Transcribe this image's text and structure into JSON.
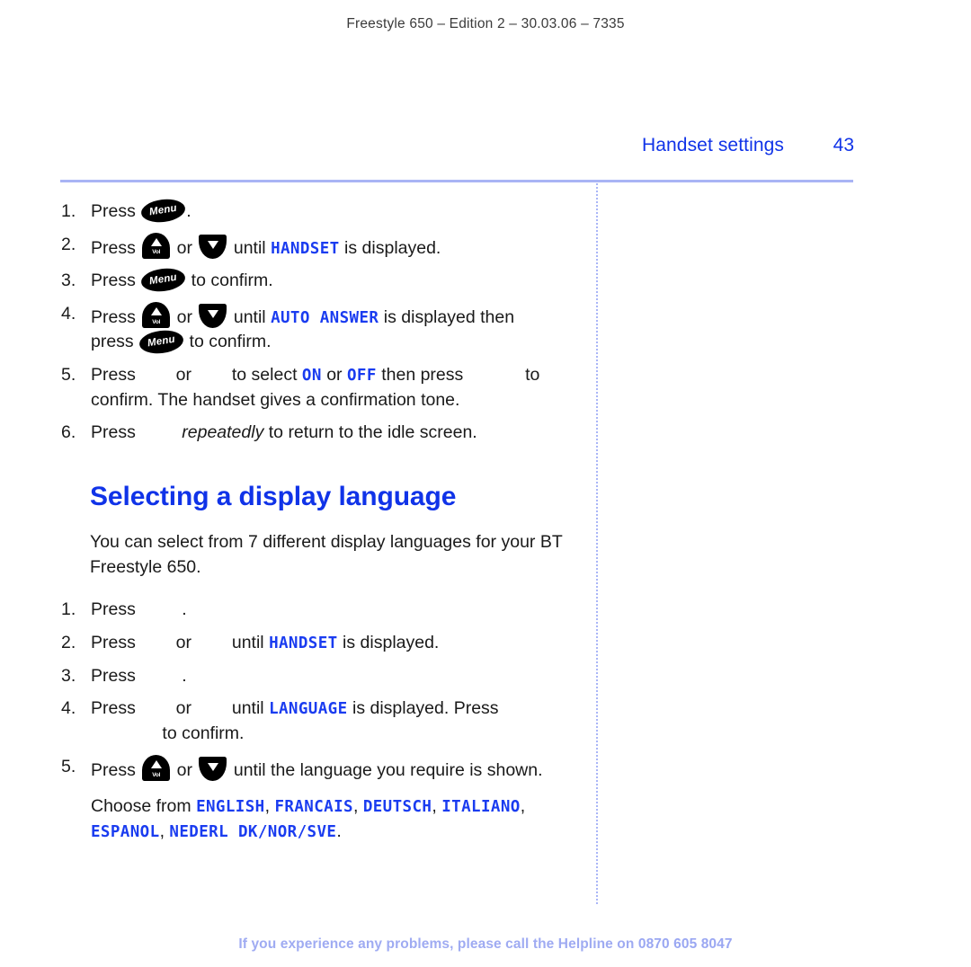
{
  "document": {
    "running_header": "Freestyle 650 – Edition 2 – 30.03.06 – 7335",
    "section_title": "Handset settings",
    "page_number": "43",
    "footer_text": "If you experience any problems, please call the Helpline on ",
    "footer_phone": "0870 605 8047"
  },
  "colors": {
    "heading_blue": "#1033e8",
    "lcd_blue": "#1a3cf0",
    "rule_blue": "#a9b4f5",
    "footer_blue": "#9fabf2",
    "body_text": "#1a1a1a"
  },
  "keys": {
    "menu_label": "Menu",
    "vol_label": "Vol"
  },
  "auto_answer_steps": [
    {
      "num": "1.",
      "parts": [
        "Press ",
        "[menu-key]",
        "."
      ]
    },
    {
      "num": "2.",
      "lead": "Press ",
      "or": " or ",
      "mid": " until ",
      "lcd": "HANDSET",
      "tail": " is displayed."
    },
    {
      "num": "3.",
      "lead": "Press ",
      "tail": " to confirm."
    },
    {
      "num": "4.",
      "lead": "Press ",
      "or": " or ",
      "mid": " until ",
      "lcd": "AUTO ANSWER",
      "tail": " is displayed then",
      "line2_lead": "press ",
      "line2_tail": " to confirm."
    },
    {
      "num": "5.",
      "lead": "Press ",
      "or": " or ",
      "mid": " to select ",
      "lcd_on": "ON",
      "between": " or ",
      "lcd_off": "OFF",
      "after": " then press ",
      "tail": " to",
      "line2": "confirm. The handset gives a confirmation tone."
    },
    {
      "num": "6.",
      "lead": "Press ",
      "emphasis": "repeatedly",
      "tail": " to return to the idle screen."
    }
  ],
  "language_section": {
    "heading": "Selecting a display language",
    "intro_line1": "You can select from 7 different display languages for",
    "intro_line2": "your BT Freestyle 650.",
    "steps": [
      {
        "num": "1.",
        "lead": "Press ",
        "tail": "."
      },
      {
        "num": "2.",
        "lead": "Press ",
        "or": " or ",
        "mid": " until ",
        "lcd": "HANDSET",
        "tail": " is displayed."
      },
      {
        "num": "3.",
        "lead": "Press ",
        "tail": "."
      },
      {
        "num": "4.",
        "lead": "Press ",
        "or": " or ",
        "mid": " until ",
        "lcd": "LANGUAGE",
        "tail": " is displayed. Press",
        "line2_tail": " to confirm."
      },
      {
        "num": "5.",
        "lead": "Press ",
        "or": " or ",
        "tail": " until the language you require is shown."
      }
    ],
    "choose_lead": "Choose from ",
    "languages_line1": [
      "ENGLISH",
      "FRANCAIS",
      "DEUTSCH",
      "ITALIANO"
    ],
    "languages_line2": [
      "ESPANOL",
      "NEDERL DK/NOR/SVE"
    ],
    "lang_1": "ENGLISH",
    "lang_2": "FRANCAIS",
    "lang_3": "DEUTSCH",
    "lang_4": "ITALIANO",
    "lang_5": "ESPANOL",
    "lang_6": "NEDERL DK/NOR/SVE"
  }
}
